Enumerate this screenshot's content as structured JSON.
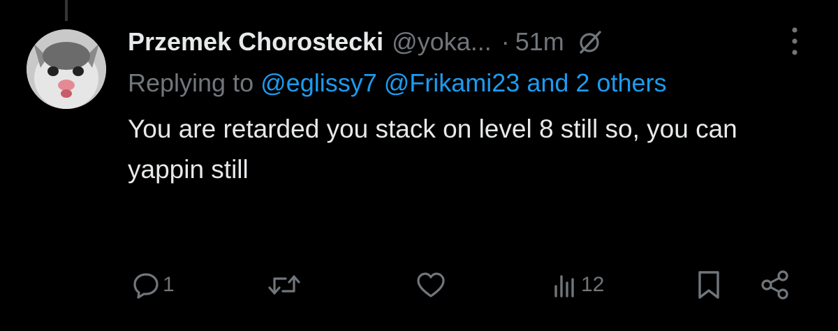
{
  "tweet": {
    "display_name": "Przemek Chorostecki",
    "handle": "@yoka...",
    "separator": "·",
    "time": "51m",
    "reply_prefix": "Replying to",
    "reply_mention_1": "@eglissy7",
    "reply_mention_2": "@Frikami23",
    "reply_others": "and 2 others",
    "text": "You are retarded you stack on level 8 still so, you can yappin still"
  },
  "actions": {
    "reply_count": "1",
    "retweet_count": "",
    "like_count": "",
    "views_count": "12"
  },
  "colors": {
    "background": "#000000",
    "primary_text": "#e7e9ea",
    "secondary_text": "#71767b",
    "link": "#1d9bf0"
  },
  "icons": [
    "grok-icon",
    "more-icon",
    "reply-icon",
    "retweet-icon",
    "like-icon",
    "views-icon",
    "bookmark-icon",
    "share-icon"
  ]
}
